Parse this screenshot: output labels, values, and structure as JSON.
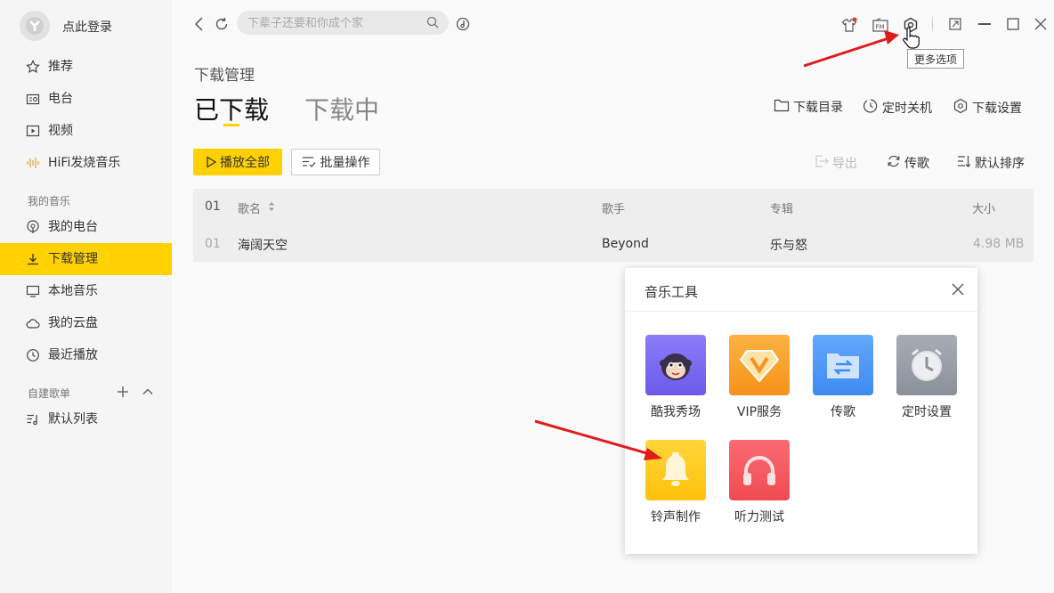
{
  "user": {
    "login_text": "点此登录"
  },
  "sidebar": {
    "nav": [
      {
        "label": "推荐",
        "icon": "star-icon"
      },
      {
        "label": "电台",
        "icon": "radio-icon"
      },
      {
        "label": "视频",
        "icon": "video-icon"
      },
      {
        "label": "HiFi发烧音乐",
        "icon": "hifi-wave-icon"
      }
    ],
    "my_music_title": "我的音乐",
    "my_music": [
      {
        "label": "我的电台",
        "icon": "podcast-icon"
      },
      {
        "label": "下载管理",
        "icon": "download-icon",
        "active": true
      },
      {
        "label": "本地音乐",
        "icon": "monitor-icon"
      },
      {
        "label": "我的云盘",
        "icon": "cloud-icon"
      },
      {
        "label": "最近播放",
        "icon": "clock-icon"
      }
    ],
    "playlists_title": "自建歌单",
    "playlists": [
      {
        "label": "默认列表",
        "icon": "playlist-icon"
      }
    ]
  },
  "search": {
    "placeholder": "下辈子还要和你成个家"
  },
  "tooltip": {
    "text": "更多选项"
  },
  "page": {
    "title": "下载管理",
    "tabs": [
      {
        "label": "已下载",
        "active": true
      },
      {
        "label": "下载中",
        "active": false
      }
    ],
    "links": {
      "dir": "下载目录",
      "timer": "定时关机",
      "settings": "下载设置"
    },
    "actions": {
      "play_all": "播放全部",
      "batch": "批量操作",
      "export": "导出",
      "transfer": "传歌",
      "sort": "默认排序"
    }
  },
  "table": {
    "headers": {
      "index": "01",
      "name": "歌名",
      "artist": "歌手",
      "album": "专辑",
      "size": "大小"
    },
    "rows": [
      {
        "index": "01",
        "name": "海阔天空",
        "artist": "Beyond",
        "album": "乐与怒",
        "size": "4.98 MB"
      }
    ]
  },
  "popup": {
    "title": "音乐工具",
    "tools": [
      {
        "label": "酷我秀场",
        "color": "#7b6cf6"
      },
      {
        "label": "VIP服务",
        "color": "#f9a534"
      },
      {
        "label": "传歌",
        "color": "#4f9bf6"
      },
      {
        "label": "定时设置",
        "color": "#9aa0aa"
      },
      {
        "label": "铃声制作",
        "color": "#ffcc1c"
      },
      {
        "label": "听力测试",
        "color": "#f5565e"
      }
    ]
  },
  "colors": {
    "accent": "#ffd100",
    "annotation_arrow": "#e01b1b"
  }
}
